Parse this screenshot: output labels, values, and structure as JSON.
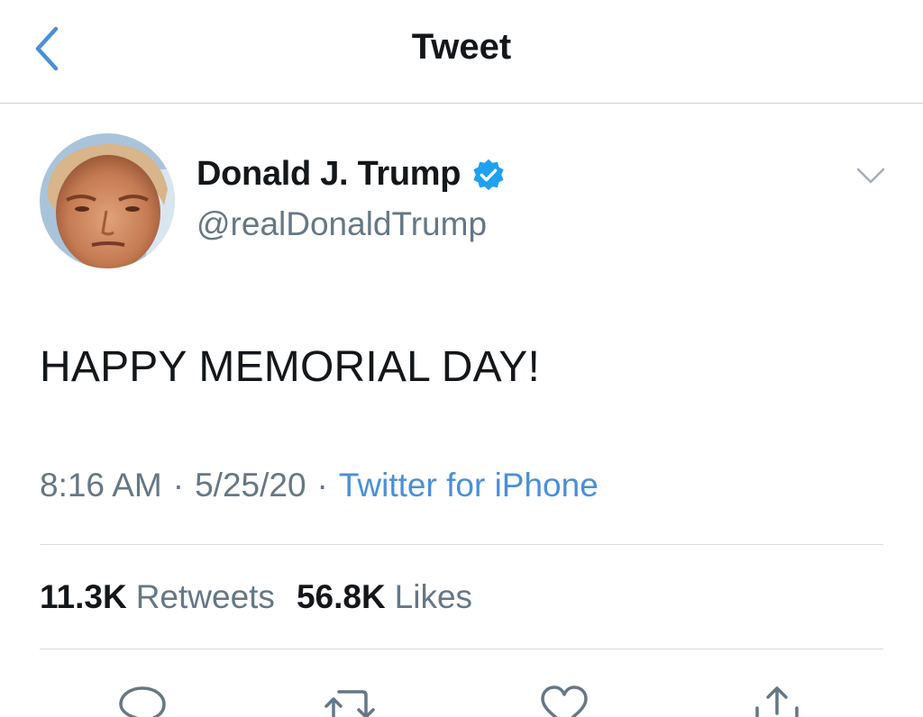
{
  "header": {
    "title": "Tweet"
  },
  "author": {
    "name": "Donald J. Trump",
    "handle": "@realDonaldTrump",
    "verified": true
  },
  "tweet": {
    "text": "HAPPY MEMORIAL DAY!"
  },
  "meta": {
    "time": "8:16 AM",
    "date": "5/25/20",
    "source": "Twitter for iPhone",
    "separator": "·"
  },
  "stats": {
    "retweets_count": "11.3K",
    "retweets_label": "Retweets",
    "likes_count": "56.8K",
    "likes_label": "Likes"
  },
  "colors": {
    "accent": "#4a8fd9",
    "verified": "#1da1f2",
    "muted": "#657786",
    "text": "#14171a",
    "divider": "#d8dadd"
  },
  "icons": [
    "back-chevron-icon",
    "verified-badge-icon",
    "chevron-down-icon",
    "reply-icon",
    "retweet-icon",
    "like-icon",
    "share-icon"
  ]
}
